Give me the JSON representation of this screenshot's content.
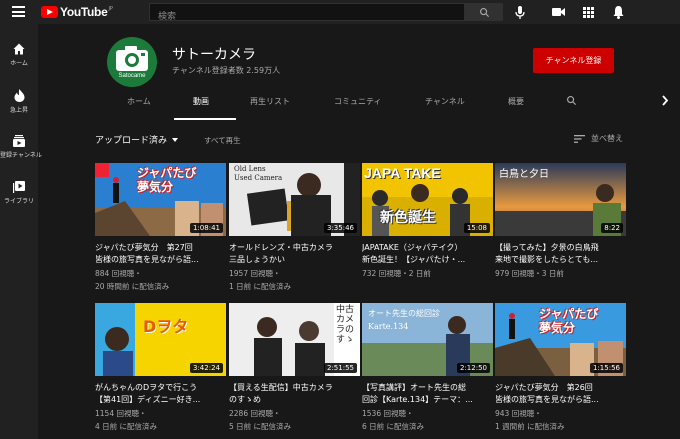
{
  "topbar": {
    "logo_text": "YouTube",
    "logo_region": "JP",
    "search_placeholder": "検索",
    "icons": [
      "menu-icon",
      "search-icon",
      "mic-icon",
      "create-video-icon",
      "apps-icon",
      "notifications-icon"
    ]
  },
  "sidebar": {
    "items": [
      {
        "label": "ホーム",
        "icon": "home-icon"
      },
      {
        "label": "急上昇",
        "icon": "trending-icon"
      },
      {
        "label": "登録チャンネル",
        "icon": "subscriptions-icon"
      },
      {
        "label": "ライブラリ",
        "icon": "library-icon"
      }
    ]
  },
  "channel": {
    "name": "サトーカメラ",
    "subscribers": "チャンネル登録者数 2.59万人",
    "avatar_brand": "Satocame",
    "subscribe_label": "チャンネル登録",
    "accent_color": "#cc0000",
    "avatar_color": "#1c7a3a"
  },
  "tabs": [
    {
      "label": "ホーム",
      "active": false
    },
    {
      "label": "動画",
      "active": true
    },
    {
      "label": "再生リスト",
      "active": false
    },
    {
      "label": "コミュニティ",
      "active": false
    },
    {
      "label": "チャンネル",
      "active": false
    },
    {
      "label": "概要",
      "active": false
    }
  ],
  "filter": {
    "sort_label": "アップロード済み",
    "play_all": "すべて再生",
    "sort_by": "並べ替え"
  },
  "videos": [
    {
      "duration": "1:08:41",
      "title1": "ジャパたび夢気分　第27回",
      "title2": "皆様の旅写真を見ながら語...",
      "views": "884 回視聴・",
      "time": "20 時間前 に配信済み",
      "thumb_text": "ジャパたび夢気分"
    },
    {
      "duration": "3:35:46",
      "title1": "オールドレンズ・中古カメラ",
      "title2": "三品しょうかい",
      "views": "1957 回視聴・",
      "time": "1 日前 に配信済み",
      "thumb_text": "Old Lens Used Camera"
    },
    {
      "duration": "15:08",
      "title1": "JAPATAKE（ジャパテイク）",
      "title2": "新色誕生！【ジャパたけ・...",
      "views": "732 回視聴・2 日前",
      "time": "",
      "thumb_text": "JAPA TAKE 新色誕生"
    },
    {
      "duration": "8:22",
      "title1": "【撮ってみた】夕景の白鳥飛",
      "title2": "来地で撮影をしたらとても...",
      "views": "979 回視聴・3 日前",
      "time": "",
      "thumb_text": "白鳥と夕日"
    },
    {
      "duration": "3:42:24",
      "title1": "がんちゃんのDヲタで行こう",
      "title2": "【第41回】ディズニー好き...",
      "views": "1154 回視聴・",
      "time": "4 日前 に配信済み",
      "thumb_text": "Dヲタ"
    },
    {
      "duration": "2:51:55",
      "title1": "【買える生配信】中古カメラ",
      "title2": "のすゝめ",
      "views": "2286 回視聴・",
      "time": "5 日前 に配信済み",
      "thumb_text": "中古カメラのすゝめ"
    },
    {
      "duration": "2:12:50",
      "title1": "【写真講評】オート先生の総",
      "title2": "回診【Karte.134】テーマ：...",
      "views": "1536 回視聴・",
      "time": "6 日前 に配信済み",
      "thumb_text": "オート先生の総回診 Karte.134"
    },
    {
      "duration": "1:15:56",
      "title1": "ジャパたび夢気分　第26回",
      "title2": "皆様の旅写真を見ながら語...",
      "views": "943 回視聴・",
      "time": "1 週間前 に配信済み",
      "thumb_text": "ジャパたび夢気分"
    }
  ]
}
